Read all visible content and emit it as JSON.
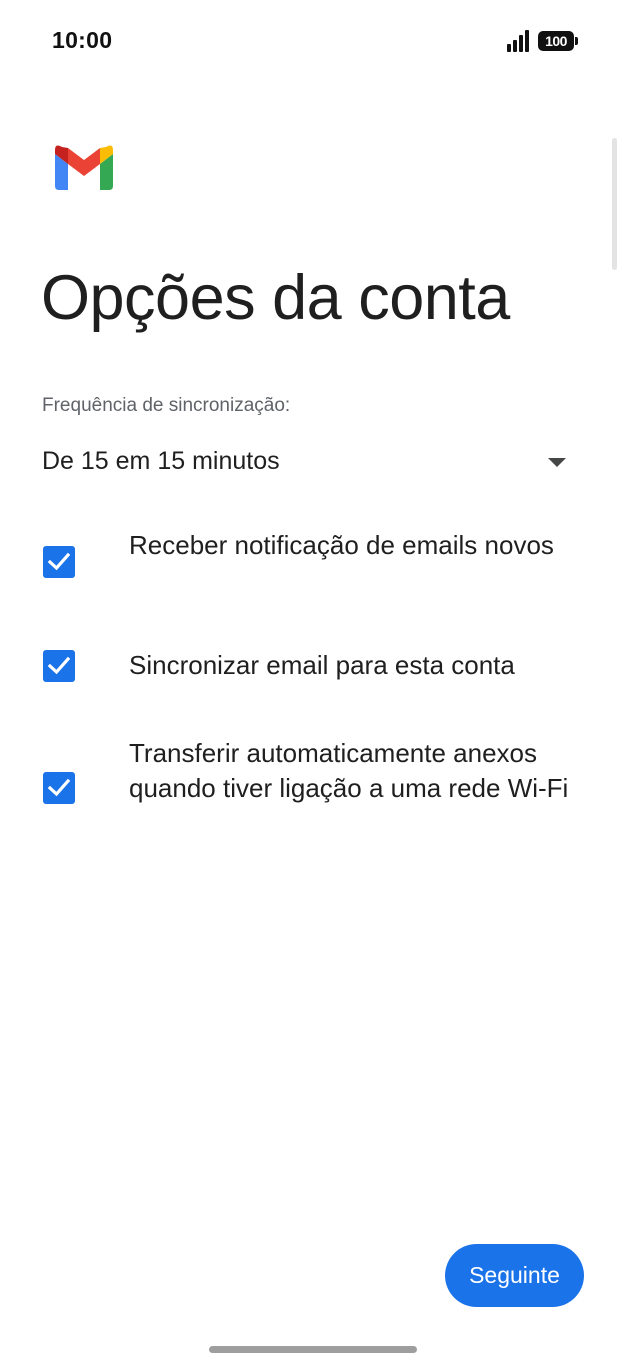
{
  "status_bar": {
    "time": "10:00",
    "battery": "100",
    "icons": [
      "signal-icon",
      "battery-icon"
    ]
  },
  "app": {
    "logo": "gmail-logo-icon",
    "colors": {
      "accent": "#1a73e8",
      "text_primary": "#1f1f1f",
      "text_secondary": "#5f6368"
    }
  },
  "page": {
    "title": "Opções da conta"
  },
  "sync": {
    "label": "Frequência de sincronização:",
    "selected_value": "De 15 em 15 minutos"
  },
  "options": [
    {
      "label": "Receber notificação de emails novos",
      "checked": true
    },
    {
      "label": "Sincronizar email para esta conta",
      "checked": true
    },
    {
      "label": "Transferir automaticamente anexos quando tiver ligação a uma rede Wi-Fi",
      "checked": true
    }
  ],
  "footer": {
    "next_label": "Seguinte"
  }
}
